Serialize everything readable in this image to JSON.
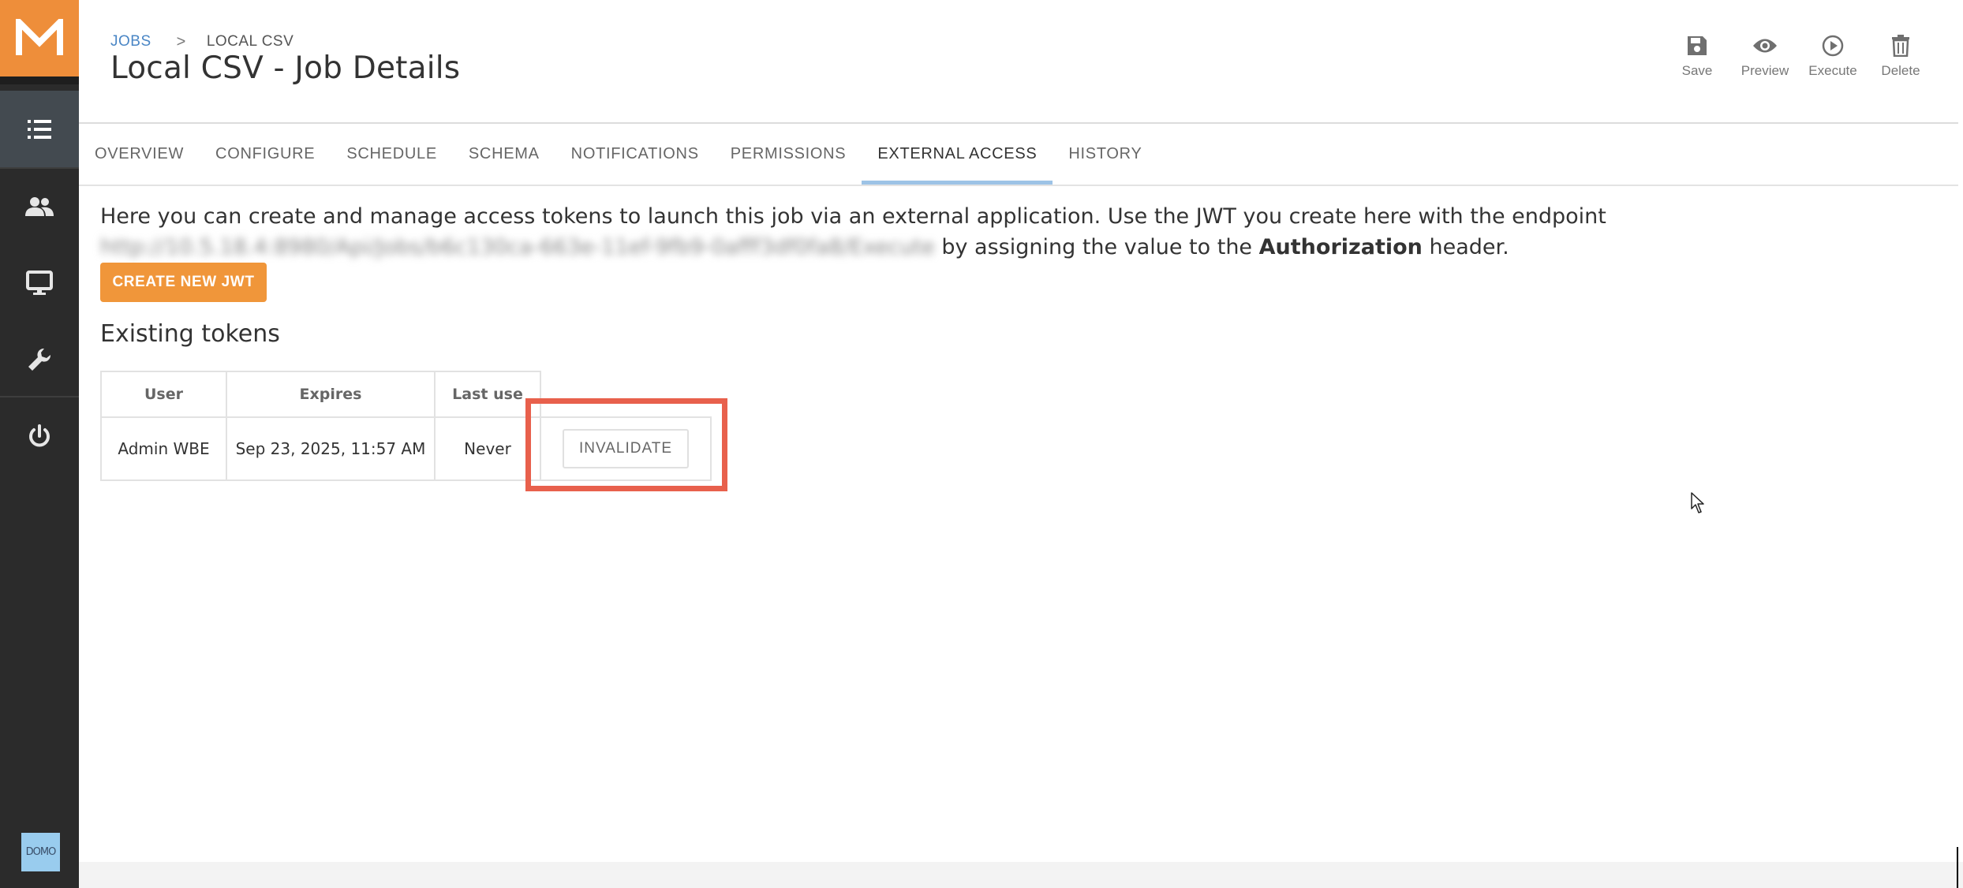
{
  "sidebar": {
    "logo_letter": "M",
    "items": [
      {
        "name": "jobs",
        "icon": "list-icon",
        "active": true
      },
      {
        "name": "users",
        "icon": "users-icon",
        "active": false
      },
      {
        "name": "agents",
        "icon": "monitor-icon",
        "active": false
      },
      {
        "name": "settings",
        "icon": "wrench-icon",
        "active": false
      },
      {
        "name": "logout",
        "icon": "power-icon",
        "active": false
      }
    ],
    "footer_logo": "DOMO"
  },
  "header": {
    "breadcrumb": {
      "parent": "JOBS",
      "separator": ">",
      "current": "LOCAL CSV"
    },
    "title": "Local CSV - Job Details",
    "toolbar": {
      "save": "Save",
      "preview": "Preview",
      "execute": "Execute",
      "delete": "Delete"
    }
  },
  "tabs": [
    {
      "label": "OVERVIEW",
      "active": false
    },
    {
      "label": "CONFIGURE",
      "active": false
    },
    {
      "label": "SCHEDULE",
      "active": false
    },
    {
      "label": "SCHEMA",
      "active": false
    },
    {
      "label": "NOTIFICATIONS",
      "active": false
    },
    {
      "label": "PERMISSIONS",
      "active": false
    },
    {
      "label": "EXTERNAL ACCESS",
      "active": true
    },
    {
      "label": "HISTORY",
      "active": false
    }
  ],
  "content": {
    "description_prefix": "Here you can create and manage access tokens to launch this job via an external application. Use the JWT you create here with the endpoint",
    "endpoint": "http://10.5.18.4:8980/Api/Jobs/b6c130ca-663e-11ef-9fb9-0afff3df0fa8/Execute",
    "description_middle": "by assigning the value to the",
    "description_bold": "Authorization",
    "description_suffix": "header.",
    "create_button": "CREATE NEW JWT",
    "section_title": "Existing tokens",
    "table": {
      "headers": {
        "user": "User",
        "expires": "Expires",
        "last_use": "Last use"
      },
      "rows": [
        {
          "user": "Admin WBE",
          "expires": "Sep 23, 2025, 11:57 AM",
          "last_use": "Never",
          "action": "INVALIDATE"
        }
      ]
    }
  },
  "colors": {
    "accent_orange": "#f0963a",
    "sidebar_bg": "#2b2b2b",
    "active_tab_underline": "#9dc3e6",
    "link_blue": "#4a86c5",
    "highlight_red": "#e8604c"
  }
}
